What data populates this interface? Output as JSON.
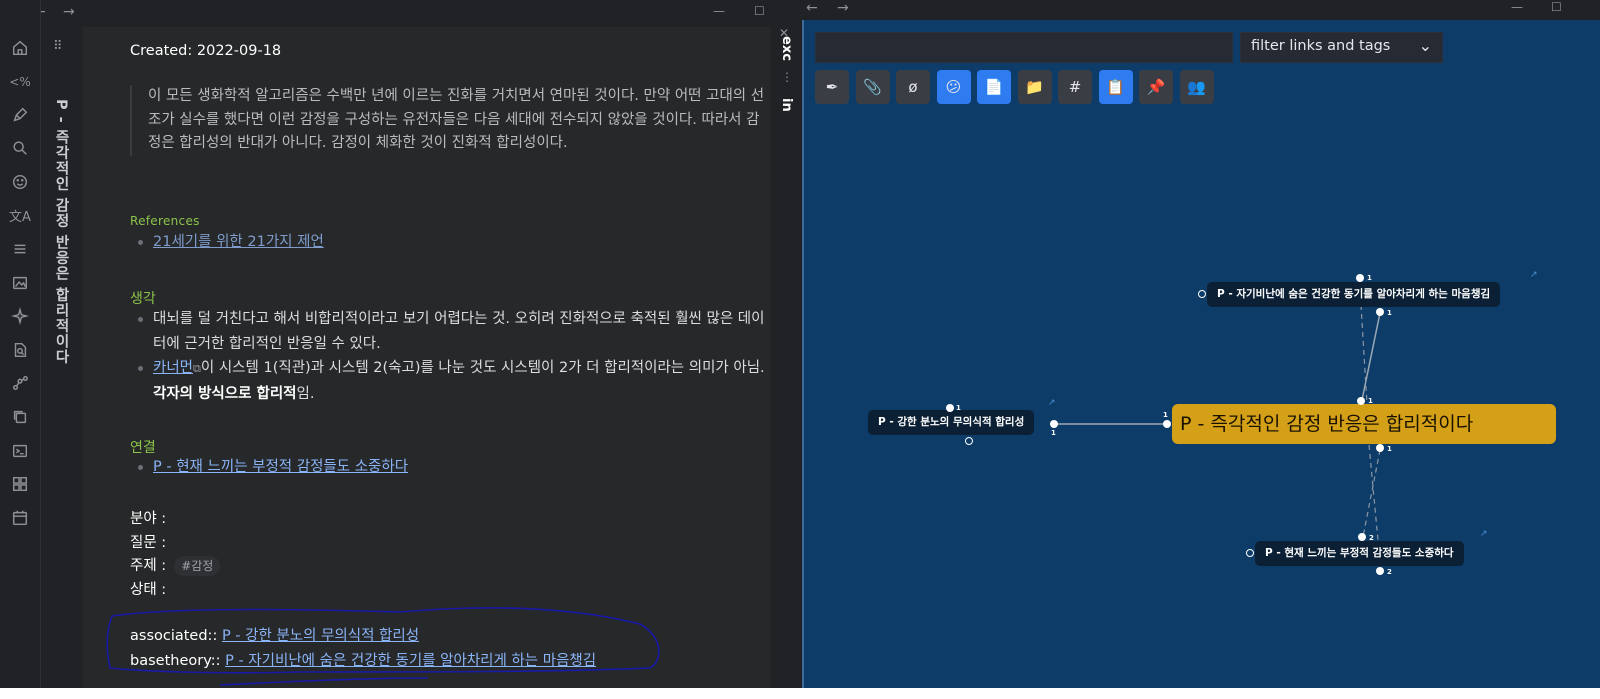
{
  "ribbon": {
    "icons": [
      "home-icon",
      "code-tag-icon",
      "pen-icon",
      "search-icon",
      "emoji-icon",
      "translate-icon",
      "list-icon",
      "image-icon",
      "sparkle-icon",
      "file-search-icon",
      "graph-icon",
      "copy-icon",
      "terminal-icon",
      "apps-icon",
      "calendar-icon"
    ]
  },
  "left_pane": {
    "vertical_title": "P - 즉각적인 감정 반응은 합리적이다",
    "created": "Created: 2022-09-18",
    "quote": "이 모든 생화학적 알고리즘은 수백만 년에 이르는 진화를 거치면서 연마된 것이다. 만약 어떤 고대의 선조가 실수를 했다면 이런 감정을 구성하는 유전자들은 다음 세대에 전수되지 않았을 것이다. 따라서 감정은 합리성의 반대가 아니다. 감정이 체화한 것이 진화적 합리성이다.",
    "references_head": "References",
    "references": [
      "21세기를 위한 21가지 제언"
    ],
    "think_head": "생각",
    "think_1": "대뇌를 덜 거친다고 해서 비합리적이라고 보기 어렵다는 것. 오히려 진화적으로 축적된 훨씬 많은 데이터에 근거한 합리적인 반응일 수 있다.",
    "think_2_link": "카너먼",
    "think_2_a": "이 시스템 1(직관)과 시스템 2(숙고)를 나눈 것도 시스템이 2가 더 합리적이라는 의미가 아님. ",
    "think_2_bold": "각자의 방식으로 합리적",
    "think_2_end": "임.",
    "conn_head": "연결",
    "conn_link": "P - 현재 느끼는 부정적 감정들도 소중하다",
    "field_label": "분야 :",
    "question_label": "질문 :",
    "topic_label": "주제 :",
    "topic_tag": "#감정",
    "status_label": "상태 :",
    "assoc_key": "associated:: ",
    "assoc_link": "P - 강한 분노의 무의식적 합리성",
    "base_key": "basetheory:: ",
    "base_link": "P - 자기비난에 숨은 건강한 동기를 알아차리게 하는 마음챙김"
  },
  "right_pane": {
    "strip_exc": "exc",
    "strip_in": "in",
    "search_value": "",
    "filter_label": "filter links and tags",
    "tool_icons": [
      "pen-tool-icon",
      "paperclip-icon",
      "empty-set-icon",
      "confused-face-icon",
      "document-icon",
      "folder-icon",
      "hashtag-icon",
      "clipboard-icon",
      "pin-icon",
      "people-icon"
    ],
    "tool_glyphs": [
      "✒",
      "📎",
      "ø",
      "😕",
      "📄",
      "📁",
      "#",
      "📋",
      "📌",
      "👥"
    ],
    "active_tools": [
      3,
      4,
      7
    ],
    "nodes": {
      "main": "P - 즉각적인 감정 반응은 합리적이다",
      "top": "P - 자기비난에 숨은 건강한 동기를 알아차리게 하는 마음챙김",
      "left": "P - 강한 분노의 무의식적 합리성",
      "bottom": "P - 현재 느끼는 부정적 감정들도 소중하다"
    },
    "port_numbers": {
      "top_above": "1",
      "top_below": "1",
      "main_top": "1",
      "main_left": "1",
      "main_below": "1",
      "left_above": "1",
      "left_right": "1",
      "bottom_above": "2",
      "bottom_below": "2"
    }
  },
  "colors": {
    "graph_background": "#0e3c68",
    "main_node": "#d4a017",
    "active_tool": "#2f7bf0",
    "link": "#8ab4f8",
    "section_heading": "#8bc34a"
  }
}
